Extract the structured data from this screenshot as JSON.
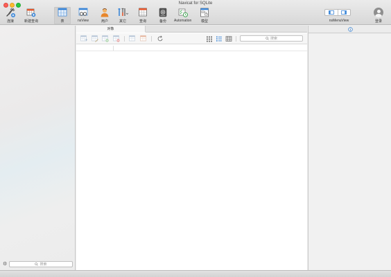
{
  "window": {
    "title": "Navicat for SQLite"
  },
  "toolbar": {
    "items": [
      {
        "label": "连接",
        "icon": "plug-connect-icon"
      },
      {
        "label": "新建查询",
        "icon": "new-query-icon"
      },
      {
        "label": "表",
        "icon": "table-icon",
        "active": true
      },
      {
        "label": "nsView",
        "icon": "view-glasses-icon"
      },
      {
        "label": "用户",
        "icon": "user-icon"
      },
      {
        "label": "其它",
        "icon": "tools-icon"
      },
      {
        "label": "查询",
        "icon": "query-icon"
      },
      {
        "label": "备份",
        "icon": "backup-icon"
      },
      {
        "label": "Automation",
        "icon": "automation-icon"
      },
      {
        "label": "模型",
        "icon": "model-icon"
      }
    ],
    "view_toggle_label": "nsMenuView",
    "login_label": "登录"
  },
  "sidebar": {
    "search_placeholder": "搜索"
  },
  "objects": {
    "tab_label": "对象",
    "search_placeholder": "搜索",
    "buttons": [
      "open-table-icon",
      "design-table-icon",
      "new-table-icon",
      "delete-table-icon",
      "import-icon",
      "export-icon",
      "refresh-icon",
      "grid-view-icon",
      "list-view-icon",
      "detail-view-icon"
    ]
  },
  "info_panel": {
    "icon": "info-icon"
  },
  "colors": {
    "accent": "#3b86d7",
    "active_tab_bg": "#d0d0d0",
    "close": "#fc5f57",
    "minimize": "#fdbc2e",
    "zoom": "#28c840"
  }
}
